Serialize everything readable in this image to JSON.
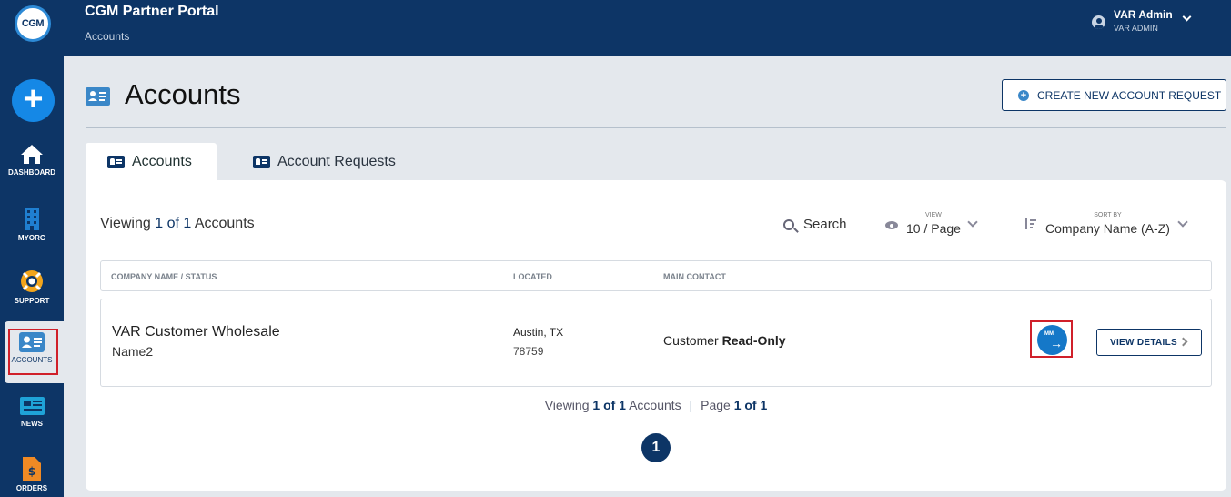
{
  "header": {
    "logo_text": "CGM",
    "title": "CGM Partner Portal",
    "breadcrumb": "Accounts",
    "user_name": "VAR Admin",
    "user_role": "VAR ADMIN"
  },
  "sidebar": {
    "items": [
      {
        "label": "DASHBOARD",
        "icon": "home-icon"
      },
      {
        "label": "MYORG",
        "icon": "building-icon"
      },
      {
        "label": "SUPPORT",
        "icon": "lifebuoy-icon"
      },
      {
        "label": "ACCOUNTS",
        "icon": "id-card-icon"
      },
      {
        "label": "NEWS",
        "icon": "newspaper-icon"
      },
      {
        "label": "ORDERS",
        "icon": "document-dollar-icon"
      }
    ]
  },
  "page": {
    "title": "Accounts",
    "create_button": "CREATE NEW ACCOUNT REQUEST"
  },
  "tabs": [
    {
      "label": "Accounts",
      "active": true
    },
    {
      "label": "Account Requests",
      "active": false
    }
  ],
  "toolbar": {
    "viewing_prefix": "Viewing",
    "viewing_current": "1",
    "viewing_of": "of",
    "viewing_total": "1",
    "viewing_suffix": "Accounts",
    "search_label": "Search",
    "view_caption": "VIEW",
    "view_value": "10 / Page",
    "sort_caption": "SORT BY",
    "sort_value": "Company Name (A-Z)"
  },
  "table": {
    "columns": [
      "COMPANY NAME / STATUS",
      "LOCATED",
      "MAIN CONTACT"
    ],
    "rows": [
      {
        "company": "VAR Customer Wholesale",
        "subtitle": "Name2",
        "city": "Austin, TX",
        "zip": "78759",
        "contact_prefix": "Customer",
        "contact_bold": "Read-Only",
        "login_icon_text": "MM",
        "details_label": "VIEW DETAILS"
      }
    ]
  },
  "footer": {
    "viewing_prefix": "Viewing",
    "viewing_range": "1 of 1",
    "viewing_suffix": "Accounts",
    "separator": "|",
    "page_prefix": "Page",
    "page_range": "1 of 1",
    "current_page": "1"
  },
  "colors": {
    "navy": "#0d3566",
    "accent_blue": "#1588e6",
    "highlight_red": "#d0202a"
  }
}
